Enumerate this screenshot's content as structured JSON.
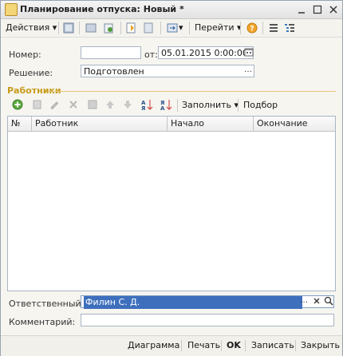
{
  "window": {
    "title": "Планирование отпуска: Новый *"
  },
  "toolbar": {
    "actions_label": "Действия",
    "goto_label": "Перейти"
  },
  "form": {
    "number_label": "Номер:",
    "number_value": "",
    "date_label": "от:",
    "date_value": "05.01.2015  0:00:00",
    "decision_label": "Решение:",
    "decision_value": "Подготовлен",
    "responsible_label": "Ответственный:",
    "responsible_value": "Филин С. Д.",
    "comment_label": "Комментарий:",
    "comment_value": ""
  },
  "workers": {
    "section_title": "Работники",
    "fill_label": "Заполнить",
    "select_label": "Подбор",
    "columns": [
      "№",
      "Работник",
      "Начало",
      "Окончание"
    ]
  },
  "footer": {
    "diagram": "Диаграмма",
    "print": "Печать",
    "ok": "OK",
    "save": "Записать",
    "close": "Закрыть"
  }
}
